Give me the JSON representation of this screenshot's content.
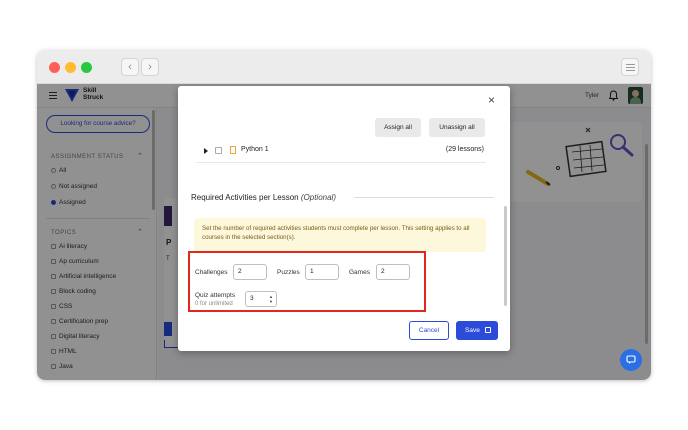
{
  "browser": {
    "back_glyph": "‹",
    "forward_glyph": "›"
  },
  "header": {
    "logo_line1": "Skill",
    "logo_line2": "Struck",
    "user_name": "Tyler"
  },
  "sidebar": {
    "advice_button": "Looking for course advice?",
    "assignment_status_label": "ASSIGNMENT STATUS",
    "status_options": [
      {
        "label": "All",
        "selected": false
      },
      {
        "label": "Not assigned",
        "selected": false
      },
      {
        "label": "Assigned",
        "selected": true
      }
    ],
    "topics_label": "TOPICS",
    "topics": [
      "Ai literacy",
      "Ap curriculum",
      "Artificial intelligence",
      "Block coding",
      "CSS",
      "Certification prep",
      "Digital literacy",
      "HTML",
      "Java"
    ]
  },
  "background": {
    "card_letter": "P",
    "card_text": "T"
  },
  "modal": {
    "close_glyph": "×",
    "assign_all": "Assign all",
    "unassign_all": "Unassign all",
    "course_name": "Python 1",
    "course_count": "(29 lessons)",
    "section_title": "Required Activities per Lesson",
    "section_optional": "(Optional)",
    "notice": "Set the number of required activities students must complete per lesson. This setting applies to all courses in the selected section(s).",
    "challenges_label": "Challenges",
    "challenges_value": "2",
    "puzzles_label": "Puzzles",
    "puzzles_value": "1",
    "games_label": "Games",
    "games_value": "2",
    "quiz_label": "Quiz attempts",
    "quiz_hint": "0 for unlimited",
    "quiz_value": "3",
    "cancel": "Cancel",
    "save": "Save"
  },
  "colors": {
    "brand_blue": "#2b4bd9",
    "highlight_red": "#e0281f",
    "notice_bg": "#fdf8dc"
  }
}
